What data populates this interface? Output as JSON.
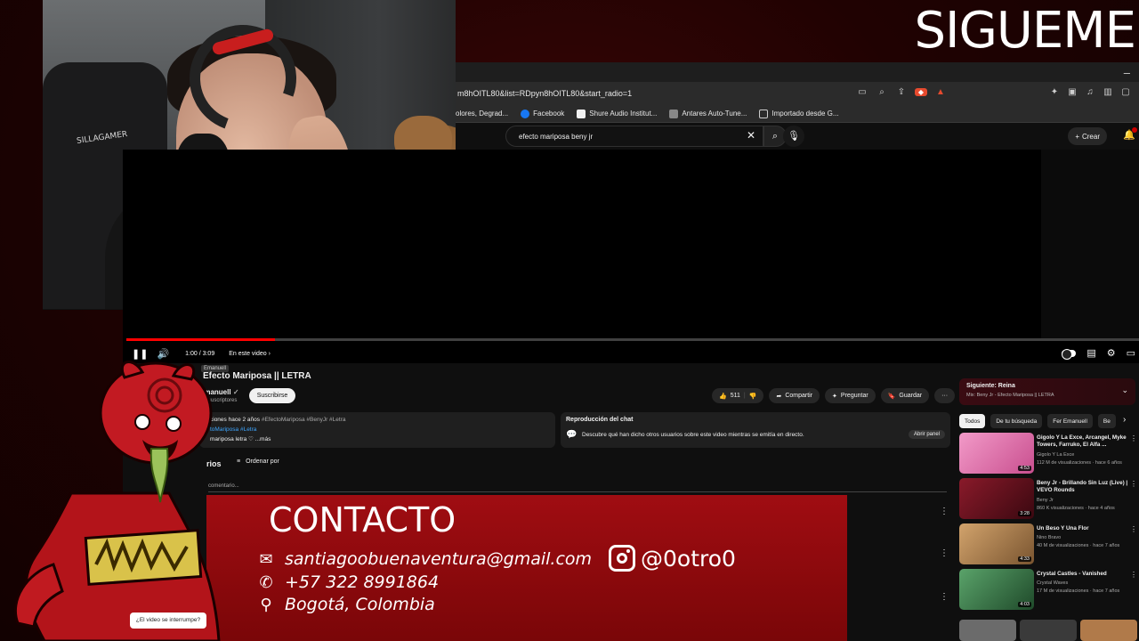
{
  "overlay": {
    "title": "SIGUEME",
    "chair_brand": "SILLAGAMER"
  },
  "browser": {
    "url": "m8hOITL80&list=RDpyn8hOITL80&start_radio=1",
    "bookmarks": [
      {
        "label": "olores, Degrad...",
        "color": "#555555"
      },
      {
        "label": "Facebook",
        "color": "#1877f2"
      },
      {
        "label": "Shure Audio Institut...",
        "color": "#f1f1f1"
      },
      {
        "label": "Antares Auto-Tune...",
        "color": "#888888"
      },
      {
        "label": "Importado desde G...",
        "color": "#555555"
      }
    ]
  },
  "youtube": {
    "search_query": "efecto mariposa beny jr",
    "create_label": "Crear",
    "player": {
      "time": "1:00 / 3:09",
      "chapter_label": "En este video",
      "progress": 0.147
    },
    "video": {
      "title": "Efecto Mariposa || LETRA",
      "tooltip_name": "Emanuell",
      "channel": "Emanuell",
      "subscribers": "suscriptores",
      "subscribe_label": "Suscribirse",
      "likes": "511",
      "share_label": "Compartir",
      "ask_label": "Preguntar",
      "save_label": "Guardar"
    },
    "description": {
      "meta": "ciones  hace 2 años",
      "tags": "#EfectoMariposa #BenyJr #Letra",
      "line2": "toMariposa #Letra",
      "line3": "mariposa letra ♡  ...más"
    },
    "chat_replay": {
      "title": "Reproducción del chat",
      "text": "Descubre qué han dicho otros usuarios sobre este video mientras se emitía en directo.",
      "button": "Abrir panel"
    },
    "comments": {
      "heading": "rios",
      "sort_label": "Ordenar por",
      "add_placeholder": "comentario..."
    },
    "up_next": {
      "title": "Siguiente: Reina",
      "subtitle": "Mix: Beny Jr - Efecto Mariposa || LETRA"
    },
    "chips": [
      "Todos",
      "De tu búsqueda",
      "Fer Emanuell",
      "Be"
    ],
    "recommendations": [
      {
        "title": "Gigolo Y La Exce, Arcangel, Myke Towers, Farruko, El Alfa ...",
        "channel": "Gigolo Y La Exce",
        "views": "112 M de visualizaciones · hace 6 años",
        "duration": "4:53",
        "color": "#e47bb1"
      },
      {
        "title": "Beny Jr - Brillando Sin Luz (Live) | VEVO Rounds",
        "channel": "Beny Jr",
        "views": "860 K visualizaciones · hace 4 años",
        "duration": "3:28",
        "color": "#6d1420"
      },
      {
        "title": "Un Beso Y Una Flor",
        "channel": "Nino Bravo",
        "views": "40 M de visualizaciones · hace 7 años",
        "duration": "4:33",
        "color": "#b8874f"
      },
      {
        "title": "Crystal Castles - Vanished",
        "channel": "Crystal Waves",
        "views": "17 M de visualizaciones · hace 7 años",
        "duration": "4:03",
        "color": "#3b7a46"
      }
    ],
    "interrupt_prompt": "¿El video se interrumpe?"
  },
  "contact": {
    "title": "CONTACTO",
    "email": "santiagoobuenaventura@gmail.com",
    "phone": "+57 322 8991864",
    "location": "Bogotá, Colombia",
    "instagram": "@0otro0"
  }
}
